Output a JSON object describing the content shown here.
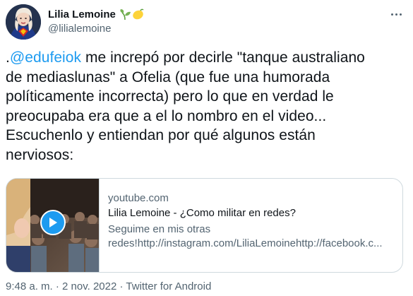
{
  "author": {
    "display_name": "Lilia Lemoine",
    "handle": "@lilialemoine",
    "name_emojis": [
      "seedling-emoji",
      "lemon-emoji"
    ]
  },
  "tweet": {
    "prefix": ".",
    "mention": "@edufeiok",
    "text_lines": [
      " me increpó por decirle \"tanque australiano",
      "de mediaslunas\" a Ofelia (que fue una humorada",
      "políticamente incorrecta) pero lo que en verdad le",
      "preocupaba era que a el lo nombro en el video...",
      "Escuchenlo y entiendan por qué algunos están",
      "nerviosos:"
    ]
  },
  "card": {
    "domain": "youtube.com",
    "title": "Lilia Lemoine - ¿Como militar en redes?",
    "description_line1": "Seguime en mis otras",
    "description_line2": "redes!http://instagram.com/LiliaLemoinehttp://facebook.c..."
  },
  "meta": {
    "time": "9:48 a. m.",
    "separator1": "·",
    "date": "2 nov. 2022",
    "separator2": "·",
    "source": "Twitter for Android"
  },
  "colors": {
    "link": "#1d9bf0",
    "text": "#0f1419",
    "secondary": "#536471",
    "border": "#cfd9de"
  }
}
